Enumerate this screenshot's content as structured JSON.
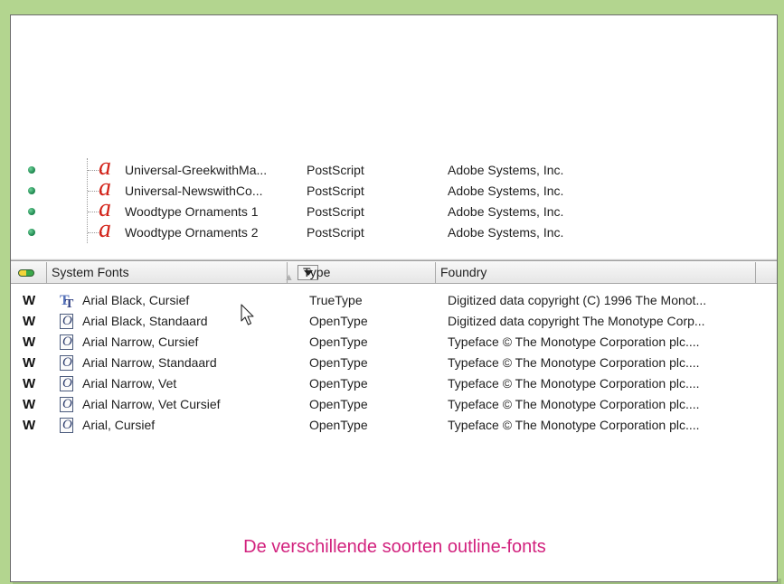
{
  "upper_list": {
    "rows": [
      {
        "name": "Universal-GreekwithMa...",
        "type": "PostScript",
        "foundry": "Adobe Systems, Inc."
      },
      {
        "name": "Universal-NewswithCo...",
        "type": "PostScript",
        "foundry": "Adobe Systems, Inc."
      },
      {
        "name": "Woodtype Ornaments 1",
        "type": "PostScript",
        "foundry": "Adobe Systems, Inc."
      },
      {
        "name": "Woodtype Ornaments 2",
        "type": "PostScript",
        "foundry": "Adobe Systems, Inc."
      }
    ],
    "row_icon": "postscript-font-icon",
    "status_icon": "green-dot-icon",
    "ps_glyph": "a"
  },
  "header": {
    "col_name": "System Fonts",
    "col_type": "Type",
    "col_foundry": "Foundry",
    "sort_glyph": "▲",
    "toggle_icon": "toggle-icon"
  },
  "system_fonts": {
    "rows": [
      {
        "flag": "W",
        "icon": "truetype",
        "name": "Arial Black, Cursief",
        "type": "TrueType",
        "foundry": "Digitized data copyright (C) 1996 The Monot..."
      },
      {
        "flag": "W",
        "icon": "opentype",
        "name": "Arial Black, Standaard",
        "type": "OpenType",
        "foundry": "Digitized data copyright The Monotype Corp..."
      },
      {
        "flag": "W",
        "icon": "opentype",
        "name": "Arial Narrow, Cursief",
        "type": "OpenType",
        "foundry": "Typeface © The Monotype Corporation plc...."
      },
      {
        "flag": "W",
        "icon": "opentype",
        "name": "Arial Narrow, Standaard",
        "type": "OpenType",
        "foundry": "Typeface © The Monotype Corporation plc...."
      },
      {
        "flag": "W",
        "icon": "opentype",
        "name": "Arial Narrow, Vet",
        "type": "OpenType",
        "foundry": "Typeface © The Monotype Corporation plc...."
      },
      {
        "flag": "W",
        "icon": "opentype",
        "name": "Arial Narrow, Vet Cursief",
        "type": "OpenType",
        "foundry": "Typeface © The Monotype Corporation plc...."
      },
      {
        "flag": "W",
        "icon": "opentype",
        "name": "Arial, Cursief",
        "type": "OpenType",
        "foundry": "Typeface © The Monotype Corporation plc...."
      }
    ],
    "tt_glyph_a": "T",
    "tt_glyph_b": "T",
    "ot_glyph": "O"
  },
  "caption": "De verschillende soorten outline-fonts",
  "colors": {
    "background": "#b3d58f",
    "caption": "#d2227e",
    "postscript_icon": "#d3241a",
    "status_dot": "#18824a"
  }
}
